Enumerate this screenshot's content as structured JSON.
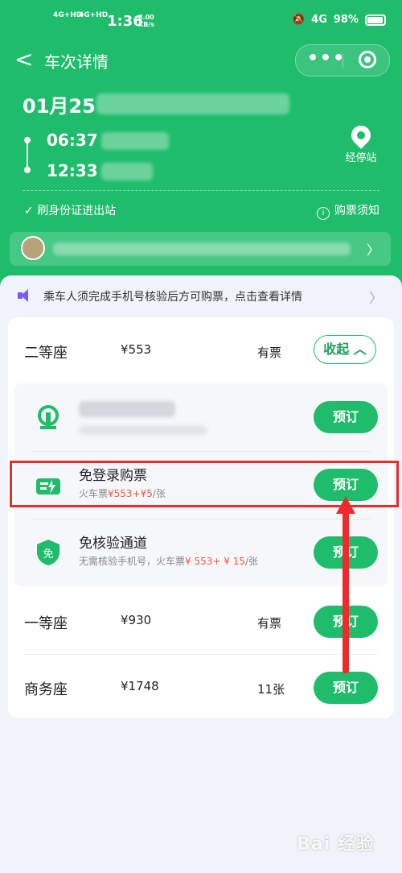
{
  "status_bar": {
    "signal_1": "4G+HD",
    "signal_2": "4G+HD",
    "time": "1:36",
    "speed_value": "8.00",
    "speed_unit": "KB/s",
    "network_right": "4G",
    "battery": "98%",
    "icons": [
      "signal-icon",
      "data-speed-icon",
      "mute-icon",
      "battery-icon"
    ]
  },
  "nav": {
    "back": "<",
    "title": "车次详情",
    "more": "•••"
  },
  "trip": {
    "date": "01月25",
    "depart_time": "06:37",
    "arrive_time": "12:33",
    "stops_label": "经停站",
    "id_card_text": "刷身份证进出站",
    "purchase_notice": "购票须知"
  },
  "notice": {
    "text": "乘车人须完成手机号核验后方可购票，点击查看详情"
  },
  "seats": [
    {
      "name": "二等座",
      "price": "¥553",
      "availability": "有票",
      "action": "收起"
    },
    {
      "name": "一等座",
      "price": "¥930",
      "availability": "有票",
      "action": "预订"
    },
    {
      "name": "商务座",
      "price": "¥1748",
      "availability": "11张",
      "action": "预订"
    }
  ],
  "channels": [
    {
      "name": "",
      "action": "预订"
    },
    {
      "name": "免登录购票",
      "desc_prefix": "火车票",
      "desc_price": "¥553+¥5",
      "desc_suffix": "/张",
      "action": "预订"
    },
    {
      "name": "免核验通道",
      "desc_prefix": "无需核验手机号，火车票",
      "desc_price": "¥ 553+ ¥ 15",
      "desc_suffix": "/张",
      "action": "预订",
      "icon_text": "免"
    }
  ],
  "watermark": "Bai 经验",
  "colors": {
    "brand_green": "#1fbc6b",
    "highlight_red": "#ee2a2a",
    "price_red": "#f05a3c",
    "notice_purple": "#7b5cf5"
  }
}
